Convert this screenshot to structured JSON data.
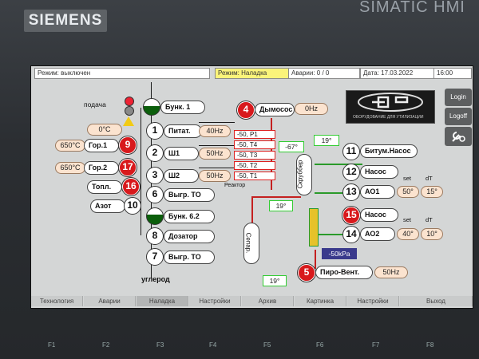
{
  "device": {
    "brand": "SIEMENS",
    "model": "SIMATIC HMI"
  },
  "statusbar": {
    "mode_label": "Режим: выключен",
    "mode_active": "Режим:  Наладка",
    "alarms": "Аварии: 0 / 0",
    "date": "Дата: 17.03.2022",
    "time": "16:00"
  },
  "side_buttons": {
    "login": "Login",
    "logoff": "Logoff",
    "tools_icon": "tools-icon"
  },
  "logo": {
    "caption": "ОБОРУДОВАНИЕ ДЛЯ УТИЛИЗАЦИИ"
  },
  "feed": {
    "label": "подача"
  },
  "equipment": {
    "bunk1": "Бунк. 1",
    "pitat": {
      "num": "1",
      "label": "Питат.",
      "freq": "40Hz"
    },
    "sh1": {
      "num": "2",
      "label": "Ш1",
      "freq": "50Hz"
    },
    "sh2": {
      "num": "3",
      "label": "Ш2",
      "freq": "50Hz"
    },
    "vygr1": {
      "num": "6",
      "label": "Выгр. ТО"
    },
    "bunk62": "Бунк. 6.2",
    "dozator": {
      "num": "8",
      "label": "Дозатор"
    },
    "vygr2": {
      "num": "7",
      "label": "Выгр. ТО"
    },
    "carbon": "углерод"
  },
  "left": {
    "top_temp": "0°C",
    "gor1": {
      "temp": "650°C",
      "label": "Гор.1",
      "num": "9"
    },
    "gor2": {
      "temp": "650°C",
      "label": "Гор.2",
      "num": "17"
    },
    "topl": {
      "label": "Топл.",
      "num": "16"
    },
    "azot": {
      "label": "Азот",
      "num": "10"
    }
  },
  "smoke": {
    "num": "4",
    "label": "Дымосос",
    "freq": "0Hz"
  },
  "reactor": {
    "label": "Реактор",
    "temps": [
      "-50, P1",
      "-50, T4",
      "-50, T3",
      "-50, T2",
      "-50, T1"
    ]
  },
  "mid": {
    "t1": "-67°",
    "t2": "19°",
    "scrubber": "Скруббер",
    "t3": "19°",
    "separator": "Сепар.",
    "pressure": "-50kPa",
    "t4": "19°"
  },
  "right": {
    "bitum": {
      "num": "11",
      "label": "Битум.Насос"
    },
    "nasos1": {
      "num": "12",
      "label": "Насос"
    },
    "ao1": {
      "num": "13",
      "label": "АО1",
      "set": "50°",
      "dt": "15°"
    },
    "nasos2": {
      "num": "15",
      "label": "Насос"
    },
    "ao2": {
      "num": "14",
      "label": "АО2",
      "set": "40°",
      "dt": "10°"
    },
    "set_label": "set",
    "dt_label": "dT",
    "piro": {
      "num": "5",
      "label": "Пиро-Вент.",
      "freq": "50Hz"
    }
  },
  "fkeys": [
    "Технология",
    "Аварии",
    "Наладка",
    "Настройки",
    "Архив",
    "Картинка",
    "Настройки",
    "Выход"
  ],
  "fkey_labels": [
    "F1",
    "F2",
    "F3",
    "F4",
    "F5",
    "F6",
    "F7",
    "F8"
  ]
}
